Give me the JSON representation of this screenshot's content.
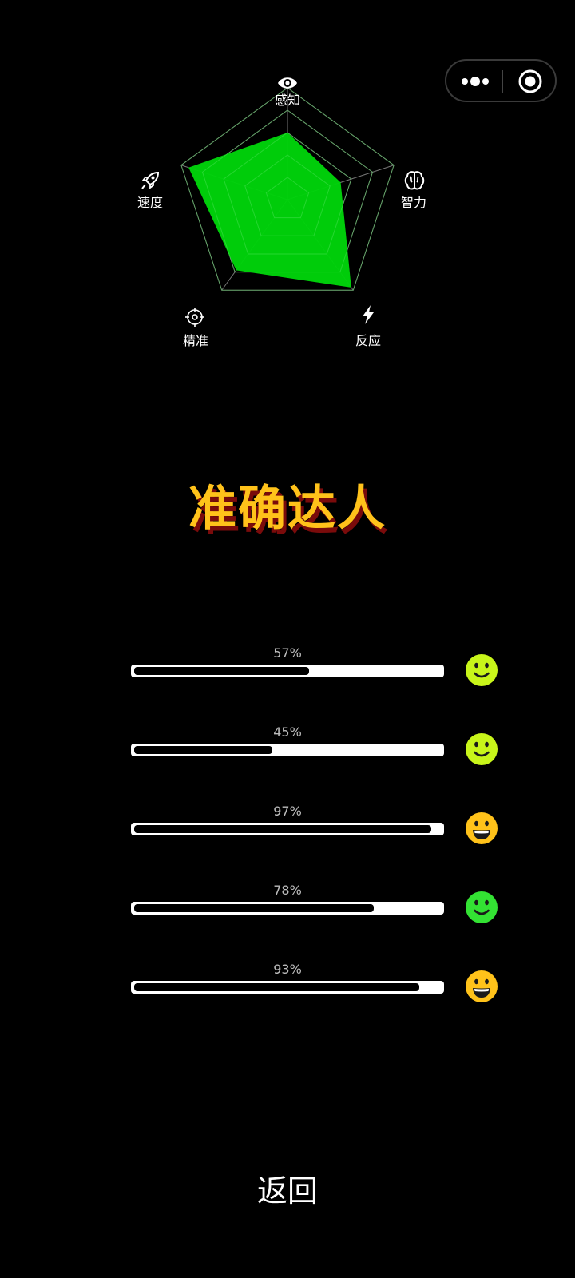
{
  "radar": {
    "labels": {
      "top": "感知",
      "right": "智力",
      "bottom_right": "反应",
      "bottom_left": "精准",
      "left": "速度"
    },
    "values": {
      "perception": 0.6,
      "intelligence": 0.5,
      "reaction": 0.97,
      "accuracy": 0.78,
      "speed": 0.93
    },
    "fill_color": "#00d30a",
    "grid_color": "#777777",
    "rings": 5
  },
  "result_title": "准确达人",
  "bars": [
    {
      "label": "57%",
      "value": 57,
      "face": "smile",
      "face_color": "#c8f51a"
    },
    {
      "label": "45%",
      "value": 45,
      "face": "smile",
      "face_color": "#c8f51a"
    },
    {
      "label": "97%",
      "value": 97,
      "face": "grin",
      "face_color": "#ffc21a"
    },
    {
      "label": "78%",
      "value": 78,
      "face": "smile",
      "face_color": "#33e233"
    },
    {
      "label": "93%",
      "value": 93,
      "face": "grin",
      "face_color": "#ffc21a"
    }
  ],
  "back_label": "返回",
  "capsule": {
    "more_icon": "more-dots-icon",
    "close_icon": "close-circle-icon"
  }
}
